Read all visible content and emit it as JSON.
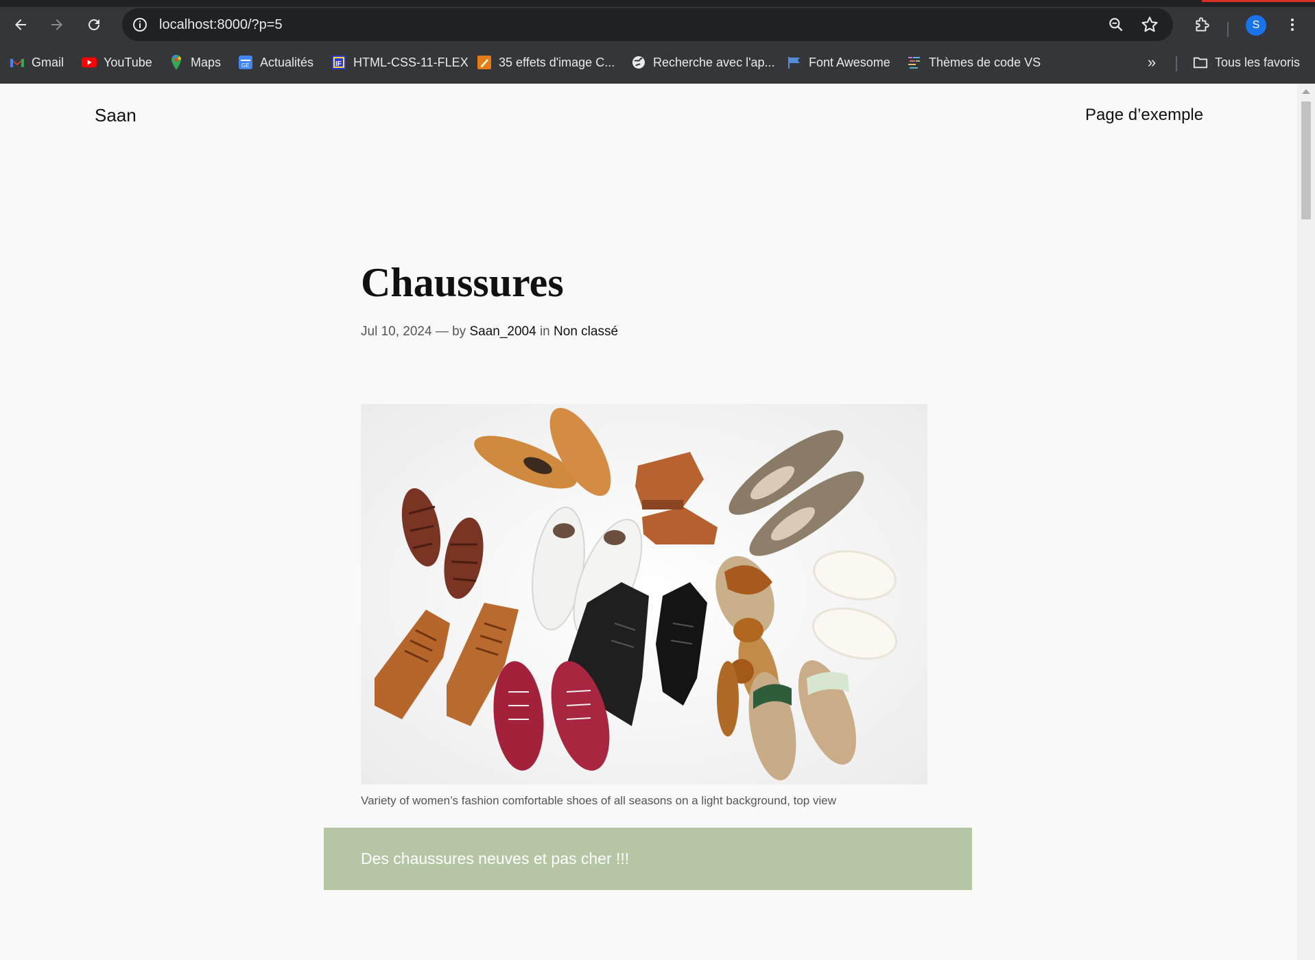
{
  "browser": {
    "url": "localhost:8000/?p=5",
    "profile_initial": "S",
    "bookmarks": [
      {
        "label": "Gmail",
        "icon": "gmail-icon"
      },
      {
        "label": "YouTube",
        "icon": "youtube-icon"
      },
      {
        "label": "Maps",
        "icon": "maps-icon"
      },
      {
        "label": "Actualités",
        "icon": "news-icon"
      },
      {
        "label": "HTML-CSS-11-FLEX",
        "icon": "flex-icon"
      },
      {
        "label": "35 effets d'image C...",
        "icon": "pencil-icon"
      },
      {
        "label": "Recherche avec l'ap...",
        "icon": "globe-icon"
      },
      {
        "label": "Font Awesome",
        "icon": "flag-icon"
      },
      {
        "label": "Thèmes de code VS",
        "icon": "code-theme-icon"
      }
    ],
    "all_bookmarks_label": "Tous les favoris",
    "colors": {
      "chrome_bg": "#35363a",
      "omnibox_bg": "#202124",
      "avatar": "#1a73e8"
    }
  },
  "site": {
    "title": "Saan",
    "nav_link": "Page d’exemple"
  },
  "post": {
    "title": "Chaussures",
    "date": "Jul 10, 2024",
    "by_sep": "— by",
    "author": "Saan_2004",
    "in_word": "in",
    "category": "Non classé",
    "image_caption": "Variety of women’s fashion comfortable shoes of all seasons on a light background, top view",
    "callout_text": "Des chaussures neuves et pas cher !!!",
    "colors": {
      "callout_bg": "#b4c6a3",
      "page_bg": "#f9f9f9"
    }
  }
}
